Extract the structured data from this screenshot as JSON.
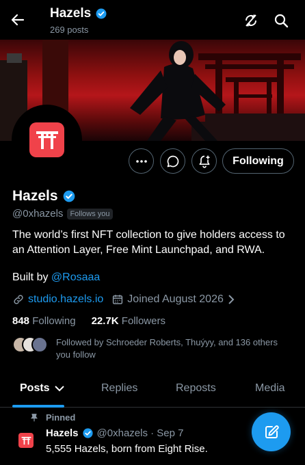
{
  "header": {
    "title": "Hazels",
    "post_count": "269 posts"
  },
  "profile": {
    "name": "Hazels",
    "handle": "@0xhazels",
    "follows_you": "Follows you",
    "bio": "The world’s first NFT collection to give holders access to an Attention Layer, Free Mint Launchpad, and RWA.",
    "built_by_prefix": "Built by",
    "built_by_link": "@Rosaaa",
    "website": "studio.hazels.io",
    "joined": "Joined August 2026",
    "following_count": "848",
    "following_label": "Following",
    "followers_count": "22.7K",
    "followers_label": "Followers",
    "followed_by": "Followed by Schroeder Roberts, Thuýyy, and 136 others you follow"
  },
  "actions": {
    "follow_state": "Following"
  },
  "tabs": [
    {
      "label": "Posts",
      "active": true
    },
    {
      "label": "Replies"
    },
    {
      "label": "Reposts"
    },
    {
      "label": "Media"
    }
  ],
  "pinned_post": {
    "pinned_label": "Pinned",
    "author": "Hazels",
    "meta": "@0xhazels · Sep 7",
    "text": "5,555 Hazels, born from Eight Rise."
  },
  "colors": {
    "accent": "#1d9bf0",
    "avatar_bg": "#f0424a",
    "background": "#000000"
  },
  "icons": [
    "back-arrow-icon",
    "verified-badge-icon",
    "refresh-icon",
    "search-icon",
    "more-icon",
    "message-icon",
    "notification-add-icon",
    "link-icon",
    "calendar-icon",
    "chevron-right-icon",
    "chevron-down-icon",
    "pin-icon",
    "torii-gate-icon",
    "compose-icon"
  ]
}
